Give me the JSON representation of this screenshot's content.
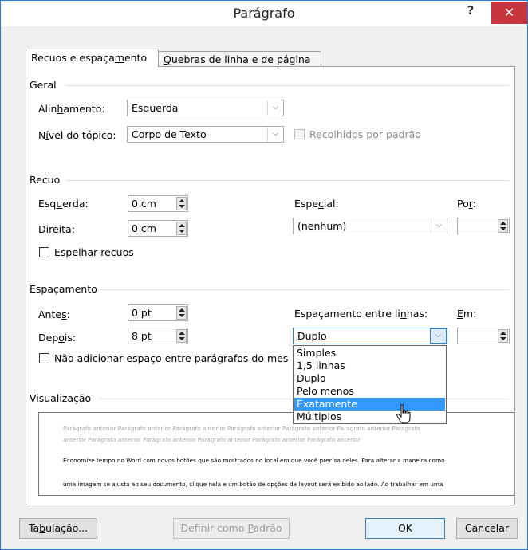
{
  "title": "Parágrafo",
  "titlebar": {
    "help": "?",
    "close": "✕"
  },
  "tabs": [
    {
      "pre": "Recuos e espaça",
      "key": "m",
      "post": "ento"
    },
    {
      "pre": "",
      "key": "Q",
      "post": "uebras de linha e de página"
    }
  ],
  "geral": {
    "section": "Geral",
    "alignment": {
      "pre": "Alin",
      "key": "h",
      "post": "amento:",
      "value": "Esquerda"
    },
    "outline": {
      "pre": "N",
      "key": "í",
      "post": "vel do tópico:",
      "value": "Corpo de Texto"
    },
    "collapsed": "Recolhidos por padrão"
  },
  "recuo": {
    "section": "Recuo",
    "left": {
      "pre": "Esq",
      "key": "u",
      "post": "erda:",
      "value": "0 cm"
    },
    "right": {
      "pre": "",
      "key": "D",
      "post": "ireita:",
      "value": "0 cm"
    },
    "special": {
      "pre": "Espe",
      "key": "c",
      "post": "ial:",
      "value": "(nenhum)"
    },
    "by": {
      "pre": "Po",
      "key": "r",
      "post": ":",
      "value": ""
    },
    "mirror": {
      "pre": "Esp",
      "key": "e",
      "post": "lhar recuos"
    }
  },
  "espacamento": {
    "section": "Espaçamento",
    "before": {
      "pre": "Ante",
      "key": "s",
      "post": ":",
      "value": "0 pt"
    },
    "after": {
      "pre": "Dep",
      "key": "o",
      "post": "is:",
      "value": "8 pt"
    },
    "line_spacing": {
      "pre": "Espaçamento entre li",
      "key": "n",
      "post": "has:",
      "value": "Duplo"
    },
    "at": {
      "pre": "",
      "key": "E",
      "post": "m:",
      "value": ""
    },
    "no_space": {
      "pre": "Não adicionar espaço entre parágra",
      "key": "f",
      "post": "os do mes"
    }
  },
  "line_spacing_options": [
    "Simples",
    "1,5 linhas",
    "Duplo",
    "Pelo menos",
    "Exatamente",
    "Múltiplos"
  ],
  "line_spacing_highlighted": "Exatamente",
  "preview": {
    "section": "Visualização",
    "prev1": "Parágrafo anterior Parágrafo anterior Parágrafo anterior Parágrafo anterior Parágrafo anterior Parágrafo anterior Parágrafo",
    "prev2": "anterior Parágrafo anterior Parágrafo anterior Parágrafo anterior Parágrafo anterior Parágrafo anterior",
    "body1": "Economize tempo no Word com novos botões que são mostrados no local em que você precisa deles. Para alterar a maneira como",
    "body2": "uma imagem se ajusta ao seu documento, clique nela e um botão de opções de layout será exibido ao lado. Ao trabalhar em uma"
  },
  "buttons": {
    "tabs": {
      "pre": "Ta",
      "key": "b",
      "post": "ulação..."
    },
    "default": {
      "pre": "Definir como ",
      "key": "P",
      "post": "adrão"
    },
    "ok": "OK",
    "cancel": "Cancelar"
  },
  "colors": {
    "accent": "#2b79d6",
    "close": "#c7363d",
    "selection": "#3399ff"
  }
}
